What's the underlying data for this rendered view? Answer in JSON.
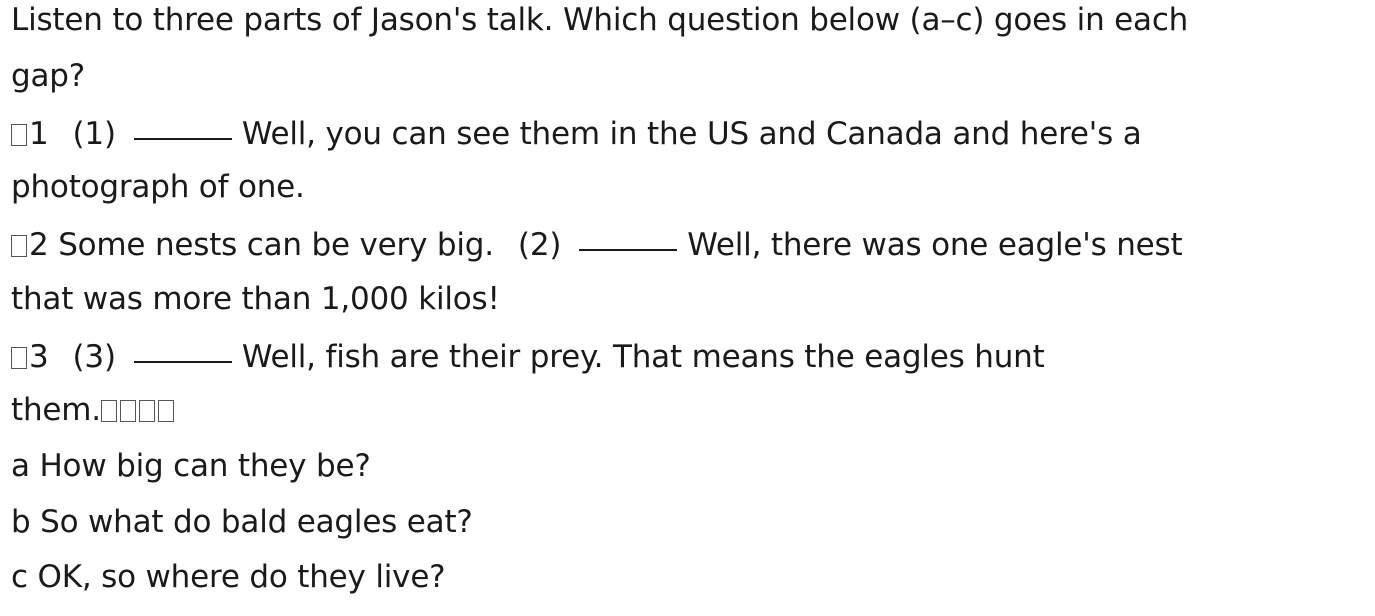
{
  "instruction": {
    "line1": "Listen to three parts of Jason's talk. Which question below (a–c) goes in each",
    "line2": "gap?"
  },
  "items": [
    {
      "number": "1",
      "gap_label": "(1)",
      "text_after": "Well, you can see them in the US and Canada and here's a",
      "continuation": "photograph of one."
    },
    {
      "number": "2",
      "text_before": "Some nests can be very big.",
      "gap_label": "(2)",
      "text_after": "Well, there was one eagle's nest",
      "continuation": "that was more than 1,000 kilos!"
    },
    {
      "number": "3",
      "gap_label": "(3)",
      "text_after": "Well, fish are their prey. That means the eagles hunt",
      "continuation": "them."
    }
  ],
  "options": [
    "a How big can they be?",
    "b So what do bald eagles eat?",
    "c OK, so where do they live?"
  ]
}
